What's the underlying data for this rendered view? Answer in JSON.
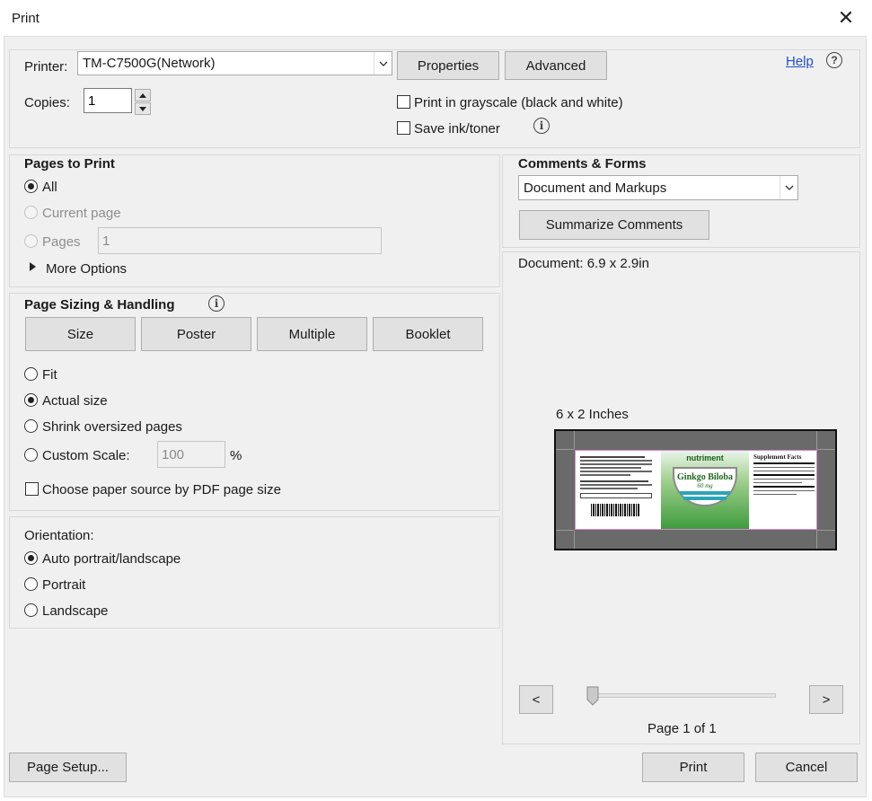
{
  "window": {
    "title": "Print",
    "close_glyph": "✕"
  },
  "printer": {
    "label": "Printer:",
    "selected": "TM-C7500G(Network)",
    "properties_label": "Properties",
    "advanced_label": "Advanced",
    "help_label": "Help",
    "help_icon_glyph": "?"
  },
  "copies": {
    "label": "Copies:",
    "value": "1"
  },
  "options": {
    "grayscale_label": "Print in grayscale (black and white)",
    "save_ink_label": "Save ink/toner"
  },
  "pages_to_print": {
    "heading": "Pages to Print",
    "all_label": "All",
    "current_page_label": "Current page",
    "pages_label": "Pages",
    "pages_value": "1",
    "more_options_label": "More Options",
    "selected": "all"
  },
  "page_sizing": {
    "heading": "Page Sizing & Handling",
    "tabs": [
      "Size",
      "Poster",
      "Multiple",
      "Booklet"
    ],
    "fit_label": "Fit",
    "actual_size_label": "Actual size",
    "shrink_label": "Shrink oversized pages",
    "custom_scale_label": "Custom Scale:",
    "custom_scale_value": "100",
    "percent_sign": "%",
    "paper_source_label": "Choose paper source by PDF page size",
    "selected": "actual_size"
  },
  "orientation": {
    "heading": "Orientation:",
    "auto_label": "Auto portrait/landscape",
    "portrait_label": "Portrait",
    "landscape_label": "Landscape",
    "selected": "auto"
  },
  "comments_forms": {
    "heading": "Comments & Forms",
    "selected": "Document and Markups",
    "summarize_label": "Summarize Comments"
  },
  "preview": {
    "document_size": "Document: 6.9 x 2.9in",
    "paper_size": "6 x 2 Inches",
    "prev_label": "<",
    "next_label": ">",
    "page_indicator": "Page 1 of 1",
    "slider_position": 0,
    "label_content": {
      "brand": "nutriment",
      "product_name": "Ginkgo Biloba",
      "strength": "60 mg",
      "supplement_facts": "Supplement Facts"
    }
  },
  "footer": {
    "page_setup_label": "Page Setup...",
    "print_label": "Print",
    "cancel_label": "Cancel"
  },
  "colors": {
    "dialog_bg": "#f0f0f0",
    "button_bg": "#e1e1e1",
    "link": "#1f4fd1",
    "preview_frame": "#6a6a6a",
    "label_green": "#3a9a3a",
    "label_teal": "#2aa5b8"
  }
}
